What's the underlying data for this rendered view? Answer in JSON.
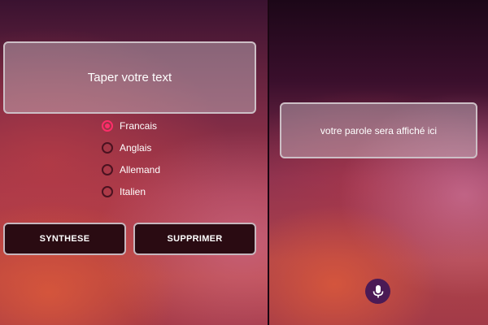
{
  "left_panel": {
    "input_placeholder": "Taper votre text",
    "languages": [
      {
        "label": "Francais",
        "checked": true
      },
      {
        "label": "Anglais",
        "checked": false
      },
      {
        "label": "Allemand",
        "checked": false
      },
      {
        "label": "Italien",
        "checked": false
      }
    ],
    "buttons": {
      "synthese_label": "SYNTHESE",
      "supprimer_label": "SUPPRIMER"
    }
  },
  "right_panel": {
    "output_text": "votre parole sera affiché ici",
    "mic_icon": "microphone-icon"
  },
  "colors": {
    "accent": "#ff2d6a",
    "button_bg": "#2a0b12",
    "box_border": "#cdbfc6"
  }
}
